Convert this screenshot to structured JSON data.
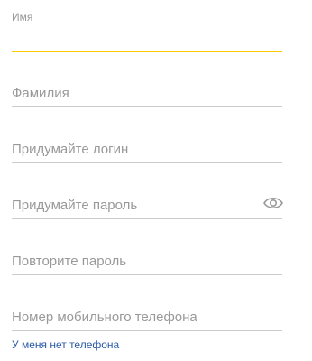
{
  "form": {
    "first_name": {
      "label": "Имя",
      "value": ""
    },
    "last_name": {
      "placeholder": "Фамилия"
    },
    "login": {
      "placeholder": "Придумайте логин"
    },
    "password": {
      "placeholder": "Придумайте пароль",
      "toggle_icon": "eye-icon"
    },
    "password_repeat": {
      "placeholder": "Повторите пароль"
    },
    "phone": {
      "placeholder": "Номер мобильного телефона"
    },
    "no_phone_link": "У меня нет телефона"
  },
  "colors": {
    "focus_underline": "#ffcc00",
    "underline": "#cccccc",
    "placeholder_text": "#999999",
    "link": "#2a5aa6"
  }
}
